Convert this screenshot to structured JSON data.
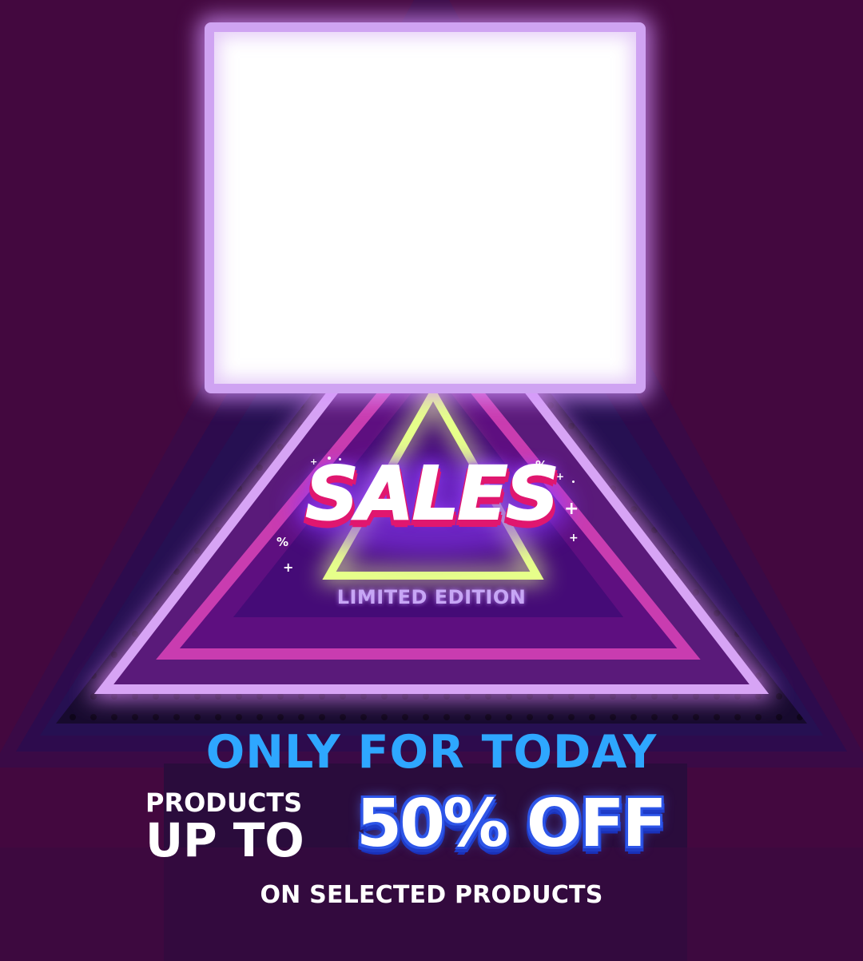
{
  "sales_badge": {
    "title": "SALES",
    "subtitle": "LIMITED EDITION"
  },
  "offer": {
    "headline": "ONLY FOR TODAY",
    "products_label": "PRODUCTS",
    "upto_label": "UP TO",
    "discount": "50% OFF",
    "footnote": "ON SELECTED PRODUCTS"
  },
  "decorations": {
    "percent_symbol": "%",
    "plus_symbol": "+"
  },
  "colors": {
    "background": "#43083f",
    "headline_blue": "#2ea7ff",
    "sales_pink": "#e0176f",
    "discount_blue": "#2d55e8",
    "neon_yellow": "#e6ff8a",
    "neon_lavender": "#cfa3f2",
    "neon_magenta": "#c93cb0"
  },
  "icons": [
    "percent-icon",
    "plus-icon",
    "dot-icon"
  ]
}
